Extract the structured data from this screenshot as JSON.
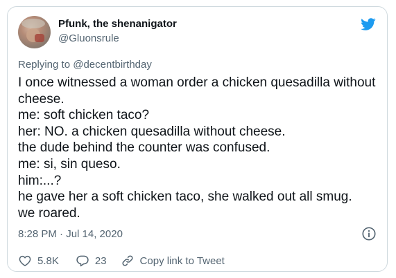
{
  "author": {
    "display_name": "Pfunk, the shenanigator",
    "handle": "@Gluonsrule"
  },
  "reply": {
    "prefix": "Replying to ",
    "mention": "@decentbirthday"
  },
  "tweet_lines": [
    "I once witnessed a woman order a chicken quesadilla without",
    "cheese.",
    "me: soft chicken taco?",
    "her: NO. a chicken quesadilla without cheese.",
    "the dude behind the counter was confused.",
    "me:  si, sin queso.",
    "him:...?",
    "he gave her a soft chicken taco, she walked out all smug.",
    "we roared."
  ],
  "timestamp": "8:28 PM · Jul 14, 2020",
  "actions": {
    "likes": "5.8K",
    "replies": "23",
    "copy_link": "Copy link to Tweet"
  },
  "icons": {
    "brand": "twitter-bird-icon",
    "info": "info-icon",
    "like": "heart-icon",
    "reply": "reply-bubble-icon",
    "link": "link-icon"
  },
  "colors": {
    "brand_blue": "#1d9bf0",
    "secondary_text": "#536471",
    "border": "#cfd9de"
  }
}
